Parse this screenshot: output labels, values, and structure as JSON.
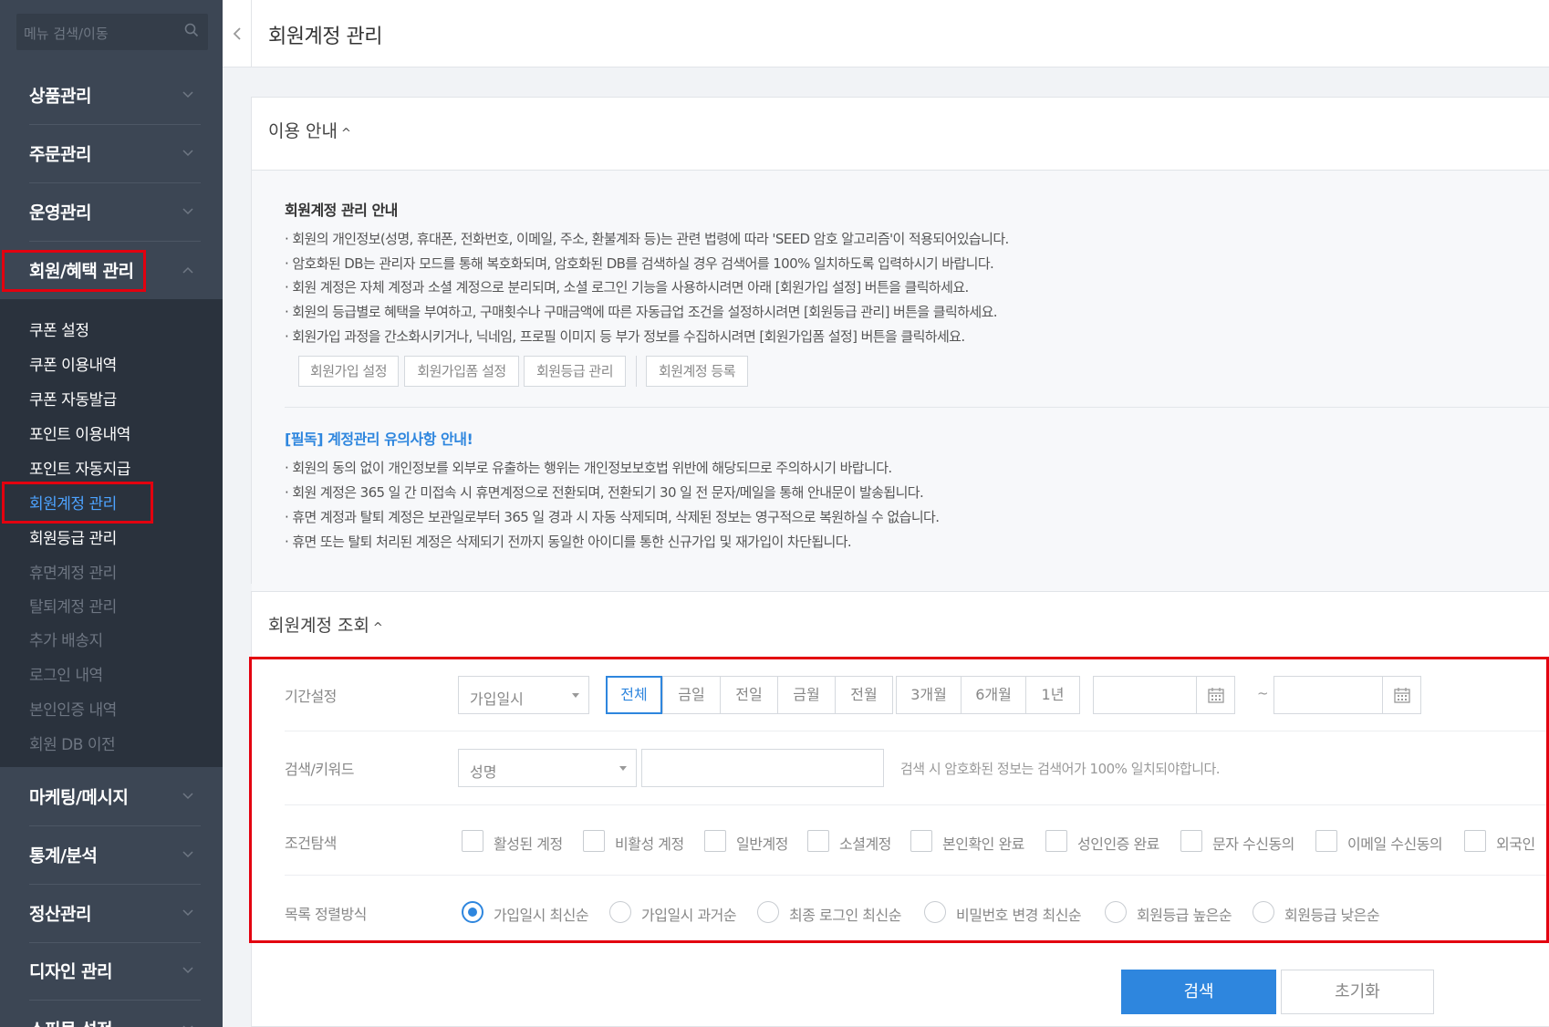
{
  "sidebar": {
    "search_placeholder": "메뉴 검색/이동",
    "menus": [
      {
        "label": "상품관리"
      },
      {
        "label": "주문관리"
      },
      {
        "label": "운영관리"
      },
      {
        "label": "회원/혜택 관리"
      },
      {
        "label": "마케팅/메시지"
      },
      {
        "label": "통계/분석"
      },
      {
        "label": "정산관리"
      },
      {
        "label": "디자인 관리"
      },
      {
        "label": "쇼핑몰 설정"
      }
    ],
    "submenu": [
      {
        "label": "쿠폰 설정"
      },
      {
        "label": "쿠폰 이용내역"
      },
      {
        "label": "쿠폰 자동발급"
      },
      {
        "label": "포인트 이용내역"
      },
      {
        "label": "포인트 자동지급"
      },
      {
        "label": "회원계정 관리"
      },
      {
        "label": "회원등급 관리"
      },
      {
        "label": "휴면계정 관리"
      },
      {
        "label": "탈퇴계정 관리"
      },
      {
        "label": "추가 배송지"
      },
      {
        "label": "로그인 내역"
      },
      {
        "label": "본인인증 내역"
      },
      {
        "label": "회원 DB 이전"
      }
    ]
  },
  "header": {
    "title": "회원계정 관리"
  },
  "guide": {
    "heading": "이용 안내",
    "title": "회원계정 관리 안내",
    "lines": [
      "· 회원의 개인정보(성명, 휴대폰, 전화번호, 이메일, 주소, 환불계좌 등)는 관련 법령에 따라 'SEED 암호 알고리즘'이 적용되어있습니다.",
      "· 암호화된 DB는 관리자 모드를 통해 복호화되며, 암호화된 DB를 검색하실 경우 검색어를 100% 일치하도록 입력하시기 바랍니다.",
      "· 회원 계정은 자체 계정과 소셜 계정으로 분리되며, 소셜 로그인 기능을 사용하시려면 아래 [회원가입 설정] 버튼을 클릭하세요.",
      "· 회원의 등급별로 혜택을 부여하고, 구매횟수나 구매금액에 따른 자동급업 조건을 설정하시려면 [회원등급 관리] 버튼을 클릭하세요.",
      "· 회원가입 과정을 간소화시키거나, 닉네임, 프로필 이미지 등 부가 정보를 수집하시려면 [회원가입폼 설정] 버튼을 클릭하세요."
    ],
    "buttons": [
      "회원가입 설정",
      "회원가입폼 설정",
      "회원등급 관리",
      "회원계정 등록"
    ],
    "notice_title": "[필독] 계정관리 유의사항 안내!",
    "notice_lines": [
      "· 회원의 동의 없이 개인정보를 외부로 유출하는 행위는 개인정보보호법 위반에 해당되므로 주의하시기 바랍니다.",
      "· 회원 계정은 365 일 간 미접속 시 휴면계정으로 전환되며, 전환되기 30 일 전 문자/메일을 통해 안내문이 발송됩니다.",
      "· 휴면 계정과 탈퇴 계정은 보관일로부터 365 일 경과 시 자동 삭제되며, 삭제된 정보는 영구적으로 복원하실 수 없습니다.",
      "· 휴면 또는 탈퇴 처리된 계정은 삭제되기 전까지 동일한 아이디를 통한 신규가입 및 재가입이 차단됩니다."
    ]
  },
  "search": {
    "heading": "회원계정 조회",
    "period": {
      "label": "기간설정",
      "select": "가입일시",
      "ranges": [
        "전체",
        "금일",
        "전일",
        "금월",
        "전월",
        "3개월",
        "6개월",
        "1년"
      ],
      "active_range": "전체",
      "tilde": "~"
    },
    "keyword": {
      "label": "검색/키워드",
      "select": "성명",
      "hint": "검색 시 암호화된 정보는 검색어가 100% 일치되야합니다."
    },
    "conditions": {
      "label": "조건탐색",
      "options": [
        "활성된 계정",
        "비활성 계정",
        "일반계정",
        "소셜계정",
        "본인확인 완료",
        "성인인증 완료",
        "문자 수신동의",
        "이메일 수신동의",
        "외국인"
      ]
    },
    "sort": {
      "label": "목록 정렬방식",
      "options": [
        "가입일시 최신순",
        "가입일시 과거순",
        "최종 로그인 최신순",
        "비밀번호 변경 최신순",
        "회원등급 높은순",
        "회원등급 낮은순"
      ],
      "selected": "가입일시 최신순"
    },
    "submit_label": "검색",
    "reset_label": "초기화"
  },
  "colors": {
    "accent": "#2e86de",
    "highlight": "#e3000f",
    "sidebar": "#3c4654"
  }
}
